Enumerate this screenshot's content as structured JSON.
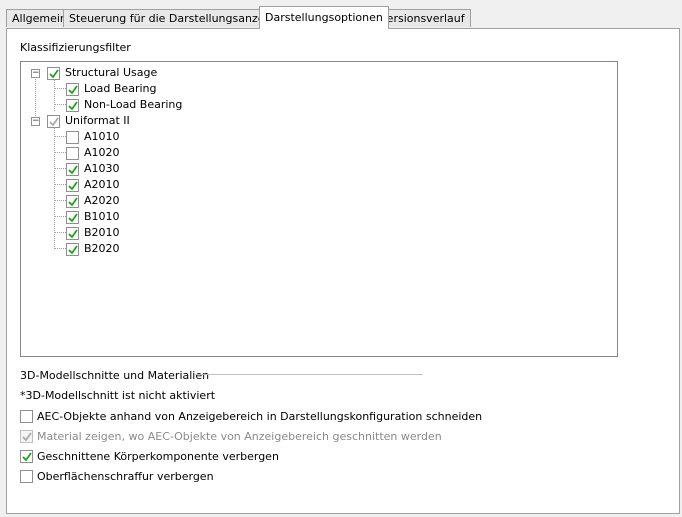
{
  "tabs": [
    {
      "label": "Allgemein"
    },
    {
      "label": "Steuerung für die Darstellungsanzeige"
    },
    {
      "label": "Darstellungsoptionen",
      "active": true
    },
    {
      "label": "Versionsverlauf"
    }
  ],
  "filter": {
    "label": "Klassifizierungsfilter",
    "groups": [
      {
        "label": "Structural Usage",
        "checked": true,
        "expanded": true,
        "children": [
          {
            "label": "Load Bearing",
            "checked": true
          },
          {
            "label": "Non-Load Bearing",
            "checked": true
          }
        ]
      },
      {
        "label": "Uniformat II",
        "checked": true,
        "expanded": true,
        "children": [
          {
            "label": "A1010",
            "checked": false
          },
          {
            "label": "A1020",
            "checked": false
          },
          {
            "label": "A1030",
            "checked": true
          },
          {
            "label": "A2010",
            "checked": true
          },
          {
            "label": "A2020",
            "checked": true
          },
          {
            "label": "B1010",
            "checked": true
          },
          {
            "label": "B2010",
            "checked": true
          },
          {
            "label": "B2020",
            "checked": true
          }
        ]
      }
    ]
  },
  "section": {
    "title": "3D-Modellschnitte und Materialien",
    "note": "*3D-Modellschnitt ist nicht aktiviert",
    "options": [
      {
        "label": "AEC-Objekte anhand von Anzeigebereich in Darstellungskonfiguration schneiden",
        "checked": false,
        "enabled": true
      },
      {
        "label": "Material zeigen, wo AEC-Objekte von Anzeigebereich geschnitten werden",
        "checked": true,
        "enabled": false
      },
      {
        "label": "Geschnittene Körperkomponente verbergen",
        "checked": true,
        "enabled": true
      },
      {
        "label": "Oberflächenschraffur verbergen",
        "checked": false,
        "enabled": true
      }
    ]
  },
  "colors": {
    "checkmark": "#21a121",
    "checkmark_disabled": "#a8a8a8"
  }
}
